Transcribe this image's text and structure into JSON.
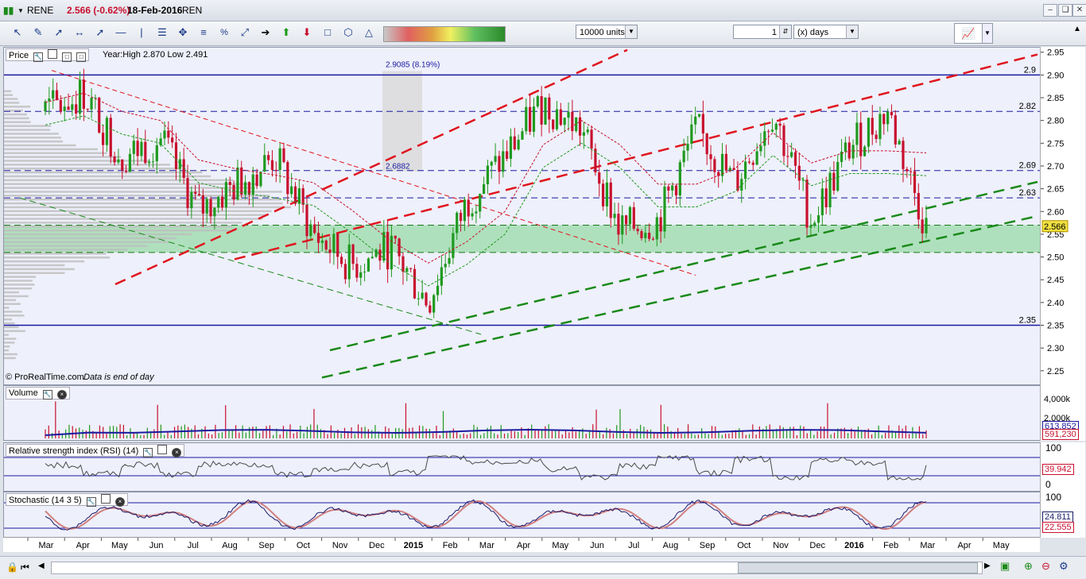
{
  "title": {
    "symbol": "RENE",
    "quote": "2.566 (-0.62%)",
    "date": "18-Feb-2016",
    "name": "REN"
  },
  "toolbar": {
    "units_value": "10000 units",
    "period_value": "1",
    "period_unit": "(x) days"
  },
  "price_panel": {
    "label": "Price",
    "info": "Year:High 2.870 Low 2.491",
    "credit": "© ProRealTime.com",
    "note": "Data is end of day",
    "measure_label": "2.9085 (8.19%)",
    "level_2688": "2.6882",
    "current_price_label": "2.566",
    "hline_labels": [
      "2.9",
      "2.82",
      "2.69",
      "2.63",
      "2.35"
    ]
  },
  "volume_panel": {
    "label": "Volume",
    "ticks": [
      "4,000k",
      "2,000k"
    ],
    "value_ma": "613,852",
    "value_vol": "591,230"
  },
  "rsi_panel": {
    "label": "Relative strength index (RSI) (14)",
    "ticks": [
      "100",
      "0"
    ],
    "value": "39.942"
  },
  "stoch_panel": {
    "label": "Stochastic (14 3 5)",
    "ticks": [
      "100"
    ],
    "value_k": "24.811",
    "value_d": "22.555"
  },
  "x_axis_labels": [
    "Mar",
    "Apr",
    "May",
    "Jun",
    "Jul",
    "Aug",
    "Sep",
    "Oct",
    "Nov",
    "Dec",
    "2015",
    "Feb",
    "Mar",
    "Apr",
    "May",
    "Jun",
    "Jul",
    "Aug",
    "Sep",
    "Oct",
    "Nov",
    "Dec",
    "2016",
    "Feb",
    "Mar",
    "Apr",
    "May"
  ],
  "colors": {
    "up_candle": "#1f9a1f",
    "down_candle": "#c8102e",
    "resistance_line": "#e0141e",
    "support_line": "#1a8a1a",
    "horizontal_level": "#1a1aa0",
    "support_zone": "#6fcf7f",
    "volume_ma": "#1a1aa0",
    "rsi_line": "#4a4a4a",
    "stoch_k": "#1a1a6a",
    "stoch_d": "#d08080"
  },
  "chart_data": {
    "type": "candlestick",
    "title": "RENE",
    "period_x": [
      "2014-03",
      "2014-04",
      "2014-05",
      "2014-06",
      "2014-07",
      "2014-08",
      "2014-09",
      "2014-10",
      "2014-11",
      "2014-12",
      "2015-01",
      "2015-02",
      "2015-03",
      "2015-04",
      "2015-05",
      "2015-06",
      "2015-07",
      "2015-08",
      "2015-09",
      "2015-10",
      "2015-11",
      "2015-12",
      "2016-01",
      "2016-02"
    ],
    "close": [
      2.82,
      2.86,
      2.72,
      2.76,
      2.6,
      2.66,
      2.72,
      2.55,
      2.48,
      2.52,
      2.4,
      2.62,
      2.72,
      2.84,
      2.78,
      2.56,
      2.58,
      2.78,
      2.66,
      2.82,
      2.58,
      2.74,
      2.82,
      2.566
    ],
    "y_axis": {
      "ylim": [
        2.22,
        2.96
      ],
      "ticks": [
        2.25,
        2.3,
        2.35,
        2.4,
        2.45,
        2.5,
        2.55,
        2.6,
        2.65,
        2.7,
        2.75,
        2.8,
        2.85,
        2.9,
        2.95
      ]
    },
    "horizontal_levels": [
      2.9,
      2.82,
      2.69,
      2.63,
      2.35
    ],
    "support_zone": [
      2.51,
      2.57
    ],
    "last_price": 2.566,
    "year_high": 2.87,
    "year_low": 2.491,
    "grid": false
  }
}
